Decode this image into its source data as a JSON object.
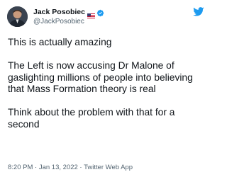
{
  "author": {
    "display_name": "Jack Posobiec",
    "handle": "@JackPosobiec",
    "flag_icon": "us-flag-icon",
    "verified_icon": "verified-badge-icon",
    "verified_color": "#1d9bf0",
    "avatar": "avatar-photo"
  },
  "platform_logo": {
    "icon": "twitter-bird-icon",
    "color": "#1d9bf0"
  },
  "tweet": {
    "paragraphs": [
      "This is actually amazing",
      "The Left is now accusing Dr Malone of gaslighting millions of people into believing that Mass Formation theory is real",
      "Think about the problem with that for a second"
    ]
  },
  "meta": {
    "time": "8:20 PM",
    "separator1": " · ",
    "date": "Jan 13, 2022",
    "separator2": " · ",
    "source": "Twitter Web App"
  },
  "colors": {
    "text": "#0f1419",
    "secondary": "#536471",
    "accent": "#1d9bf0"
  }
}
